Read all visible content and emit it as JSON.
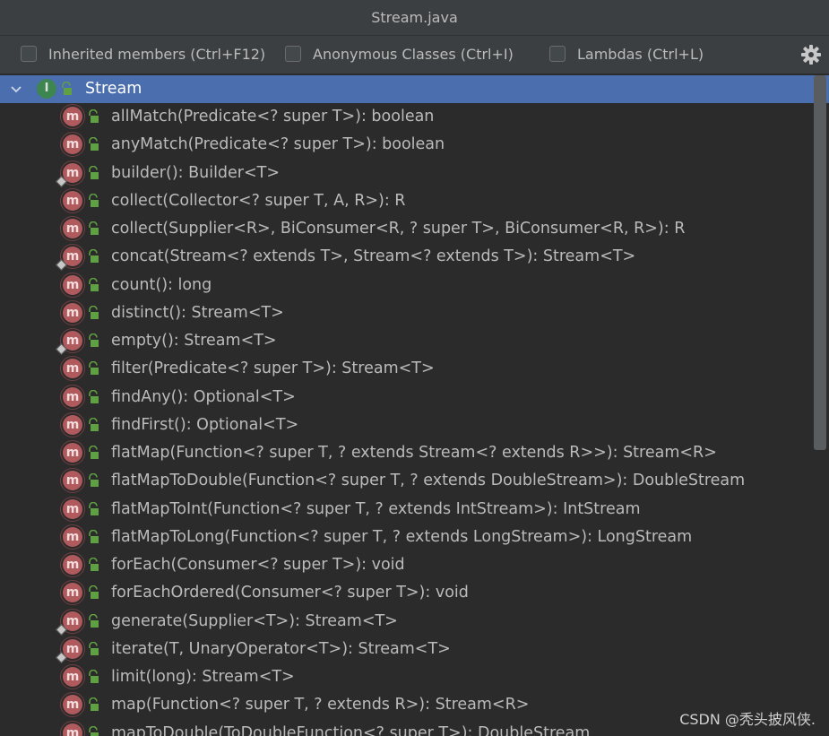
{
  "window": {
    "title": "Stream.java"
  },
  "toolbar": {
    "inherited_label": "Inherited members (Ctrl+F12)",
    "anonymous_label": "Anonymous Classes (Ctrl+I)",
    "lambdas_label": "Lambdas (Ctrl+L)",
    "inherited_checked": false,
    "anonymous_checked": false,
    "lambdas_checked": false
  },
  "tree": {
    "root": {
      "label": "Stream",
      "badge": "I",
      "icon": "interface-icon"
    },
    "members": [
      {
        "label": "allMatch(Predicate<? super T>): boolean",
        "static": false
      },
      {
        "label": "anyMatch(Predicate<? super T>): boolean",
        "static": false
      },
      {
        "label": "builder(): Builder<T>",
        "static": true
      },
      {
        "label": "collect(Collector<? super T, A, R>): R",
        "static": false
      },
      {
        "label": "collect(Supplier<R>, BiConsumer<R, ? super T>, BiConsumer<R, R>): R",
        "static": false
      },
      {
        "label": "concat(Stream<? extends T>, Stream<? extends T>): Stream<T>",
        "static": true
      },
      {
        "label": "count(): long",
        "static": false
      },
      {
        "label": "distinct(): Stream<T>",
        "static": false
      },
      {
        "label": "empty(): Stream<T>",
        "static": true
      },
      {
        "label": "filter(Predicate<? super T>): Stream<T>",
        "static": false
      },
      {
        "label": "findAny(): Optional<T>",
        "static": false
      },
      {
        "label": "findFirst(): Optional<T>",
        "static": false
      },
      {
        "label": "flatMap(Function<? super T, ? extends Stream<? extends R>>): Stream<R>",
        "static": false
      },
      {
        "label": "flatMapToDouble(Function<? super T, ? extends DoubleStream>): DoubleStream",
        "static": false
      },
      {
        "label": "flatMapToInt(Function<? super T, ? extends IntStream>): IntStream",
        "static": false
      },
      {
        "label": "flatMapToLong(Function<? super T, ? extends LongStream>): LongStream",
        "static": false
      },
      {
        "label": "forEach(Consumer<? super T>): void",
        "static": false
      },
      {
        "label": "forEachOrdered(Consumer<? super T>): void",
        "static": false
      },
      {
        "label": "generate(Supplier<T>): Stream<T>",
        "static": true
      },
      {
        "label": "iterate(T, UnaryOperator<T>): Stream<T>",
        "static": true
      },
      {
        "label": "limit(long): Stream<T>",
        "static": false
      },
      {
        "label": "map(Function<? super T, ? extends R>): Stream<R>",
        "static": false
      },
      {
        "label": "mapToDouble(ToDoubleFunction<? super T>): DoubleStream",
        "static": false
      }
    ],
    "method_badge": "m"
  },
  "watermark": "CSDN @秃头披风侠.",
  "colors": {
    "selection": "#4b6eaf",
    "method_badge": "#b05a5d",
    "interface_badge": "#3e8650",
    "lock_green": "#5fa042"
  }
}
